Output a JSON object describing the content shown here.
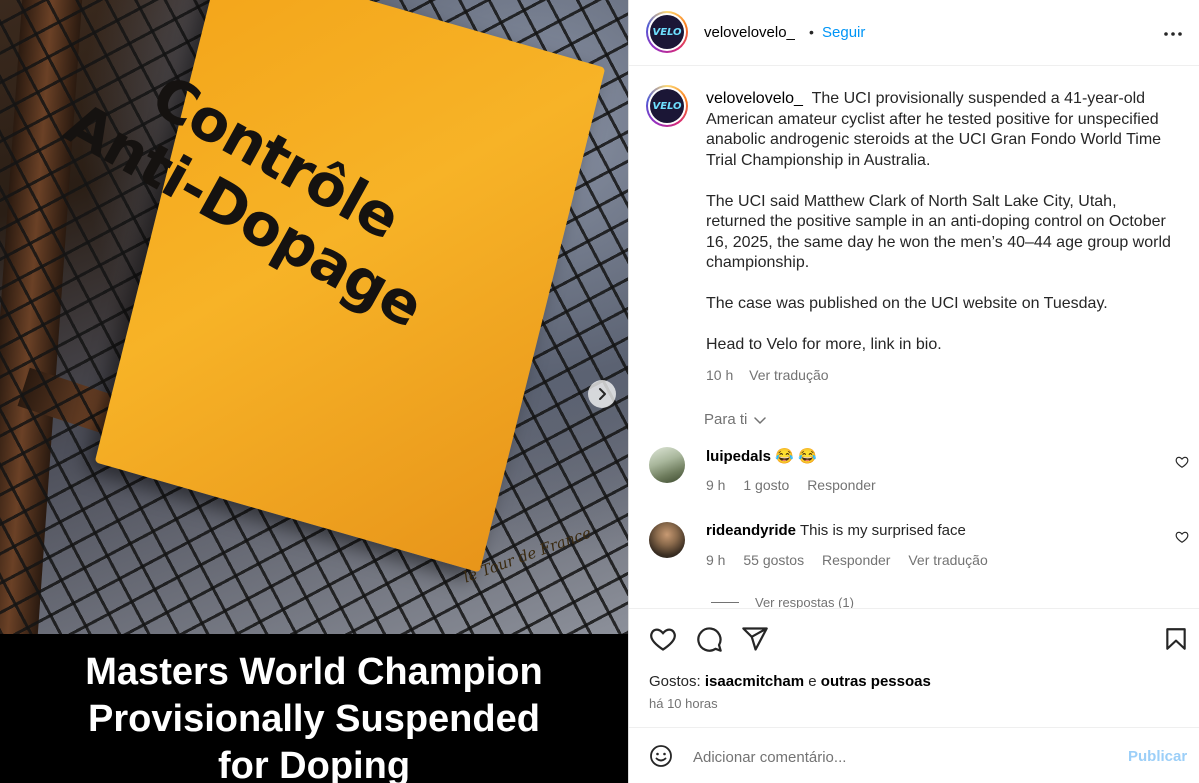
{
  "media": {
    "sign_lines": [
      "Contrôle",
      "Anti-Dopage"
    ],
    "logo_text": "le Tour de France",
    "headline_lines": [
      "Masters World Champion",
      "Provisionally Suspended",
      "for Doping"
    ],
    "next_icon": "chevron-right-icon"
  },
  "header": {
    "avatar_text": "VELO",
    "username": "velovelovelo_",
    "dot": "•",
    "follow_label": "Seguir",
    "more_icon": "more-horizontal-icon"
  },
  "caption": {
    "username": "velovelovelo_",
    "paragraphs": [
      "The UCI provisionally suspended a 41-year-old American amateur cyclist after he tested positive for unspecified anabolic androgenic steroids at the UCI Gran Fondo World Time Trial Championship in Australia.",
      "The UCI said Matthew Clark of North Salt Lake City, Utah, returned the positive sample in an anti-doping control on October 16, 2025, the same day he won the men’s 40–44 age group world championship.",
      "The case was published on the UCI website on Tuesday.",
      "Head to Velo for more, link in bio."
    ],
    "time": "10 h",
    "translate": "Ver tradução"
  },
  "for_you": "Para ti",
  "comments": [
    {
      "username": "luipedals",
      "text": "😂 😂",
      "time": "9 h",
      "likes": "1 gosto",
      "reply": "Responder",
      "translate": ""
    },
    {
      "username": "rideandyride",
      "text": "This is my surprised face",
      "time": "9 h",
      "likes": "55 gostos",
      "reply": "Responder",
      "translate": "Ver tradução"
    }
  ],
  "view_replies": "Ver respostas (1)",
  "likes": {
    "prefix": "Gostos:",
    "user": "isaacmitcham",
    "conj": "e",
    "others": "outras pessoas"
  },
  "time_ago": "há 10 horas",
  "add_comment": {
    "placeholder": "Adicionar comentário...",
    "publish_label": "Publicar"
  },
  "colors": {
    "accent": "#0095f6",
    "publish_disabled": "#9ccff8",
    "secondary_text": "#737373",
    "sign_yellow": "#f7b327"
  }
}
